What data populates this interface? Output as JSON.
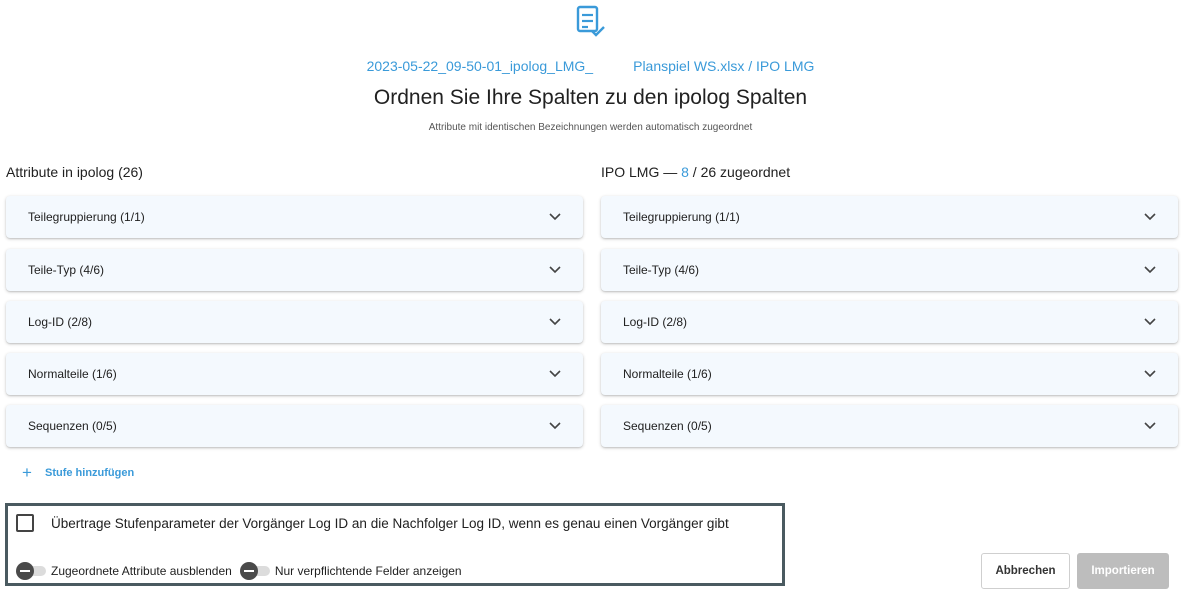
{
  "header": {
    "icon": "list-check-icon",
    "file_name": "2023-05-22_09-50-01_ipolog_LMG_",
    "sheet_name": "Planspiel WS.xlsx / IPO LMG",
    "title": "Ordnen Sie Ihre Spalten zu den ipolog Spalten",
    "subtitle": "Attribute mit identischen Bezeichnungen werden automatisch zugeordnet"
  },
  "left_column": {
    "header": "Attribute in ipolog (26)",
    "groups": [
      {
        "label": "Teilegruppierung (1/1)"
      },
      {
        "label": "Teile-Typ (4/6)"
      },
      {
        "label": "Log-ID (2/8)"
      },
      {
        "label": "Normalteile (1/6)"
      },
      {
        "label": "Sequenzen (0/5)"
      }
    ]
  },
  "right_column": {
    "header_prefix": "IPO LMG — ",
    "mapped_count": "8",
    "header_suffix": " / 26 zugeordnet",
    "groups": [
      {
        "label": "Teilegruppierung (1/1)"
      },
      {
        "label": "Teile-Typ (4/6)"
      },
      {
        "label": "Log-ID (2/8)"
      },
      {
        "label": "Normalteile (1/6)"
      },
      {
        "label": "Sequenzen (0/5)"
      }
    ]
  },
  "add_step": {
    "label": "Stufe hinzufügen"
  },
  "options": {
    "transfer_checkbox": {
      "label": "Übertrage Stufenparameter der Vorgänger Log ID an die Nachfolger Log ID, wenn es genau einen Vorgänger gibt",
      "checked": false
    },
    "hide_mapped_toggle": {
      "label": "Zugeordnete Attribute ausblenden",
      "on": false
    },
    "required_only_toggle": {
      "label": "Nur verpflichtende Felder anzeigen",
      "on": false
    }
  },
  "buttons": {
    "cancel": "Abbrechen",
    "import": "Importieren"
  },
  "colors": {
    "accent": "#3a9ad9",
    "panel_bg": "#f4f9fe",
    "disabled_button": "#bdbdbd"
  }
}
